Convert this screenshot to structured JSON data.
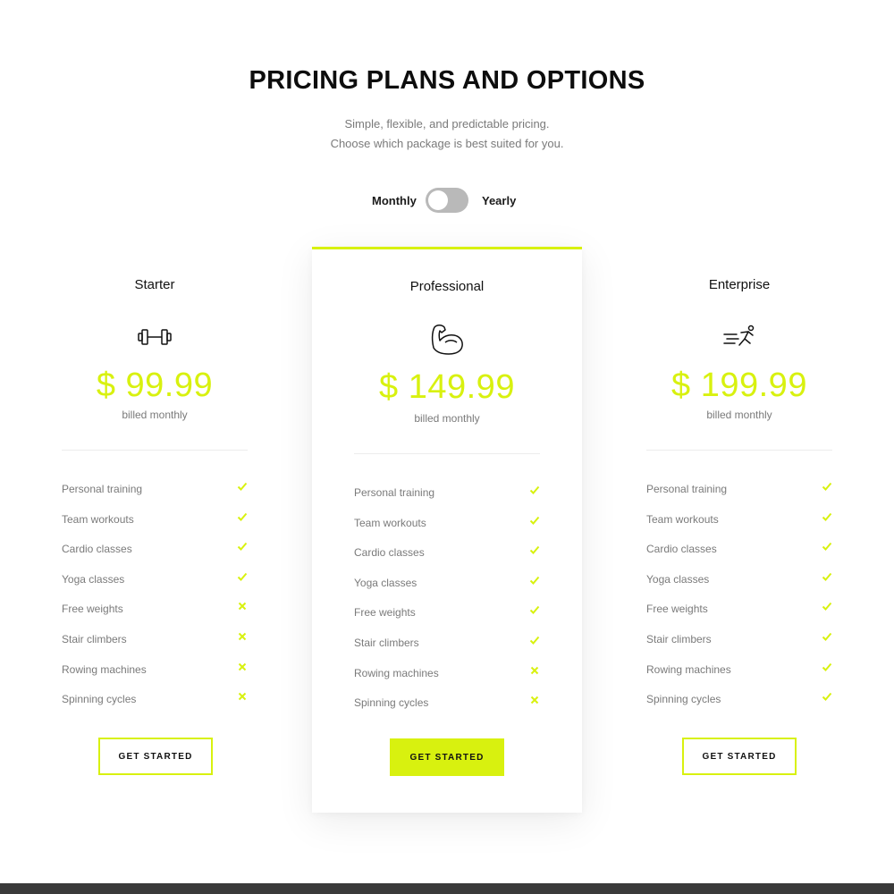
{
  "header": {
    "title": "PRICING PLANS AND OPTIONS",
    "subtitle_line1": "Simple, flexible, and predictable pricing.",
    "subtitle_line2": "Choose which package is best suited for you."
  },
  "billing_toggle": {
    "left_label": "Monthly",
    "right_label": "Yearly",
    "selected": "Monthly"
  },
  "colors": {
    "accent": "#d8f10f",
    "text_dark": "#111111",
    "text_muted": "#7a7a7a",
    "toggle_track": "#b9b9b9",
    "footer": "#3a3a3a"
  },
  "plans": [
    {
      "name": "Starter",
      "icon": "dumbbell-icon",
      "price": "$ 99.99",
      "billing": "billed monthly",
      "cta": "GET STARTED",
      "featured": false,
      "features": [
        {
          "label": "Personal training",
          "included": true
        },
        {
          "label": "Team workouts",
          "included": true
        },
        {
          "label": "Cardio classes",
          "included": true
        },
        {
          "label": "Yoga classes",
          "included": true
        },
        {
          "label": "Free weights",
          "included": false
        },
        {
          "label": "Stair climbers",
          "included": false
        },
        {
          "label": "Rowing machines",
          "included": false
        },
        {
          "label": "Spinning cycles",
          "included": false
        }
      ]
    },
    {
      "name": "Professional",
      "icon": "flexed-arm-icon",
      "price": "$ 149.99",
      "billing": "billed monthly",
      "cta": "GET STARTED",
      "featured": true,
      "features": [
        {
          "label": "Personal training",
          "included": true
        },
        {
          "label": "Team workouts",
          "included": true
        },
        {
          "label": "Cardio classes",
          "included": true
        },
        {
          "label": "Yoga classes",
          "included": true
        },
        {
          "label": "Free weights",
          "included": true
        },
        {
          "label": "Stair climbers",
          "included": true
        },
        {
          "label": "Rowing machines",
          "included": false
        },
        {
          "label": "Spinning cycles",
          "included": false
        }
      ]
    },
    {
      "name": "Enterprise",
      "icon": "running-person-icon",
      "price": "$ 199.99",
      "billing": "billed monthly",
      "cta": "GET STARTED",
      "featured": false,
      "features": [
        {
          "label": "Personal training",
          "included": true
        },
        {
          "label": "Team workouts",
          "included": true
        },
        {
          "label": "Cardio classes",
          "included": true
        },
        {
          "label": "Yoga classes",
          "included": true
        },
        {
          "label": "Free weights",
          "included": true
        },
        {
          "label": "Stair climbers",
          "included": true
        },
        {
          "label": "Rowing machines",
          "included": true
        },
        {
          "label": "Spinning cycles",
          "included": true
        }
      ]
    }
  ]
}
